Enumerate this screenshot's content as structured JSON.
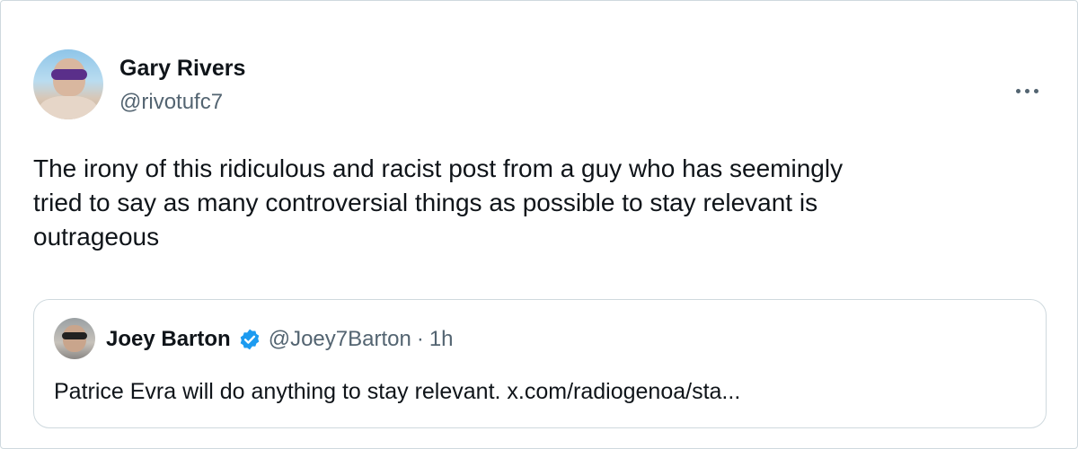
{
  "tweet": {
    "author": {
      "display_name": "Gary Rivers",
      "handle": "@rivotufc7"
    },
    "text_lines": [
      "The irony of this ridiculous and racist post from a guy who has seemingly",
      "tried to say as many controversial things as possible to stay relevant is",
      "outrageous"
    ],
    "more_icon": "more-horizontal-icon"
  },
  "quote": {
    "author": {
      "display_name": "Joey Barton",
      "handle": "@Joey7Barton",
      "verified": true,
      "verified_icon": "verified-badge-icon",
      "verified_color": "#1d9bf0"
    },
    "separator": "·",
    "time": "1h",
    "text": "Patrice Evra will do anything to stay relevant. x.com/radiogenoa/sta..."
  },
  "colors": {
    "text_primary": "#0f1419",
    "text_secondary": "#536471",
    "border": "#cfd9de",
    "accent": "#1d9bf0"
  }
}
